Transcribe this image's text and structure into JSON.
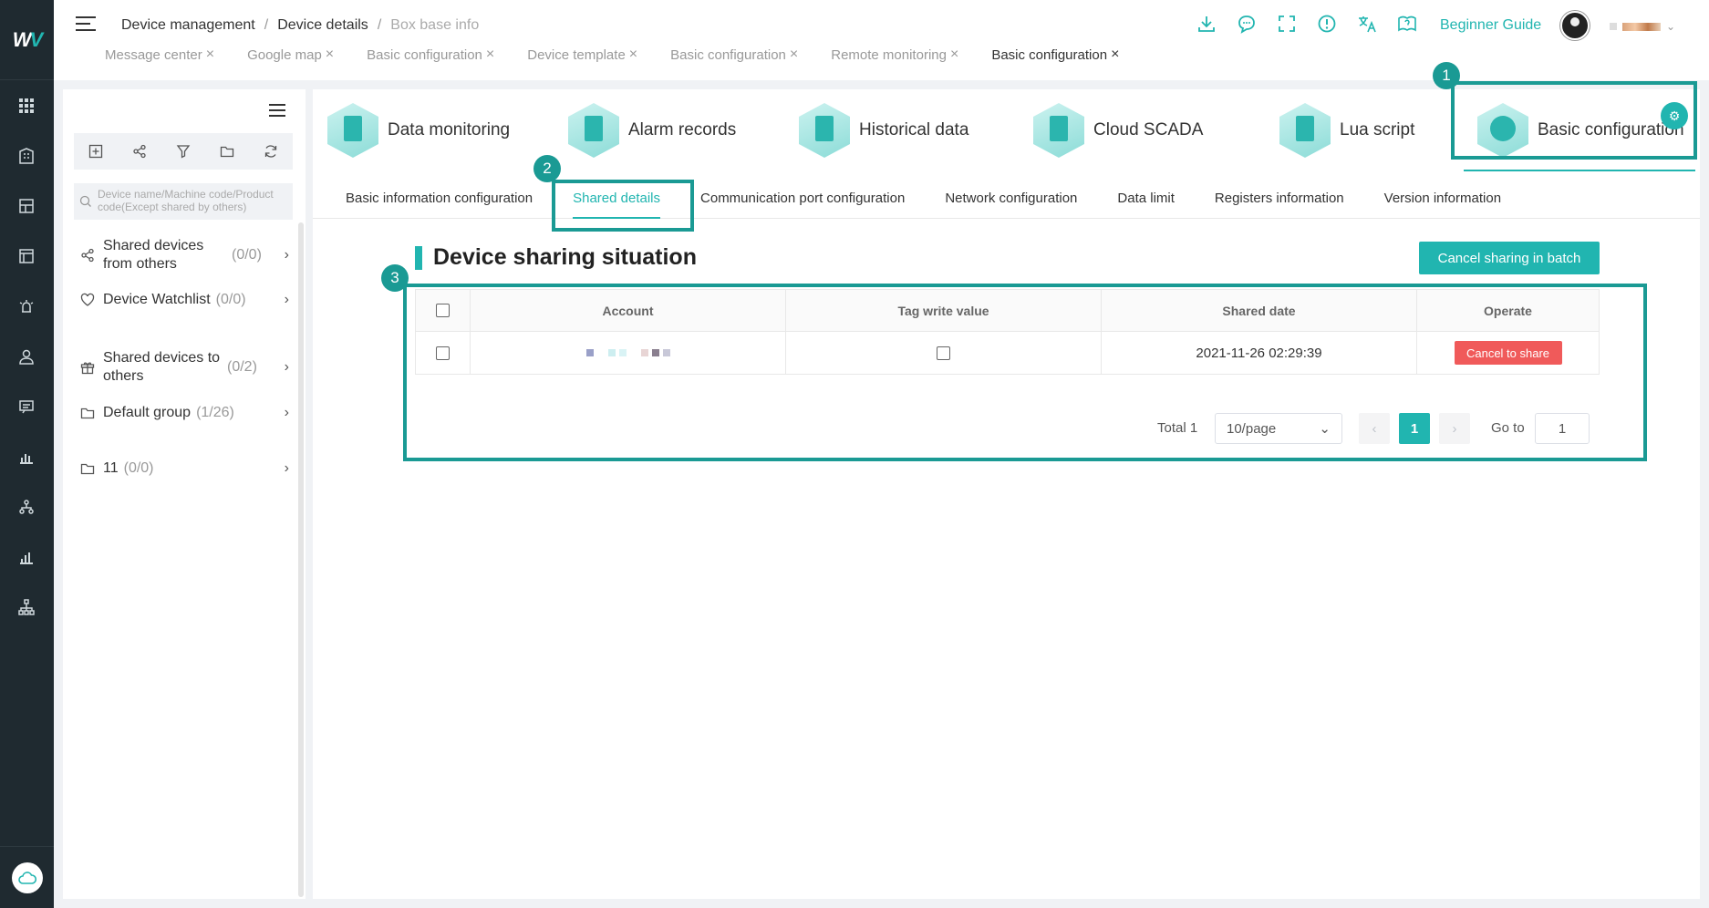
{
  "header": {
    "breadcrumb": [
      "Device management",
      "Device details",
      "Box base info"
    ],
    "breadcrumb_sep": "/",
    "tabs": [
      {
        "label": "Message center",
        "active": false
      },
      {
        "label": "Google map",
        "active": false
      },
      {
        "label": "Basic configuration",
        "active": false
      },
      {
        "label": "Device template",
        "active": false
      },
      {
        "label": "Basic configuration",
        "active": false
      },
      {
        "label": "Remote monitoring",
        "active": false
      },
      {
        "label": "Basic configuration",
        "active": true
      }
    ],
    "beginner_guide": "Beginner Guide",
    "icons": [
      "download-icon",
      "chat-icon",
      "fullscreen-icon",
      "alert-icon",
      "translate-icon",
      "help-book-icon"
    ]
  },
  "sidebar": {
    "search_placeholder": "Device name/Machine code/Product code(Except shared by others)",
    "items": [
      {
        "label": "Shared devices from others",
        "count": "(0/0)",
        "icon": "share-icon"
      },
      {
        "label": "Device Watchlist",
        "count": "(0/0)",
        "icon": "heart-icon"
      },
      {
        "label": "Shared devices to others",
        "count": "(0/2)",
        "icon": "gift-icon"
      },
      {
        "label": "Default group",
        "count": "(1/26)",
        "icon": "folder-icon"
      },
      {
        "label": "11",
        "count": "(0/0)",
        "icon": "folder-icon"
      }
    ]
  },
  "modules": [
    {
      "label": "Data monitoring"
    },
    {
      "label": "Alarm records"
    },
    {
      "label": "Historical data"
    },
    {
      "label": "Cloud SCADA"
    },
    {
      "label": "Lua script"
    },
    {
      "label": "Basic configuration",
      "active": true
    }
  ],
  "subtabs": [
    {
      "label": "Basic information configuration"
    },
    {
      "label": "Shared details",
      "active": true
    },
    {
      "label": "Communication port configuration"
    },
    {
      "label": "Network configuration"
    },
    {
      "label": "Data limit"
    },
    {
      "label": "Registers information"
    },
    {
      "label": "Version information"
    }
  ],
  "section": {
    "title": "Device sharing situation",
    "batch_button": "Cancel sharing in batch"
  },
  "table": {
    "headers": [
      "Account",
      "Tag write value",
      "Shared date",
      "Operate"
    ],
    "rows": [
      {
        "shared_date": "2021-11-26 02:29:39",
        "action": "Cancel to share"
      }
    ]
  },
  "pager": {
    "total": "Total 1",
    "page_size": "10/page",
    "current_page": "1",
    "goto_label": "Go to",
    "goto_value": "1"
  },
  "annotations": [
    "1",
    "2",
    "3"
  ],
  "colors": {
    "accent": "#21b5b0",
    "danger": "#f05a5a",
    "annotation": "#1a9a94",
    "rail": "#1f2a30"
  }
}
